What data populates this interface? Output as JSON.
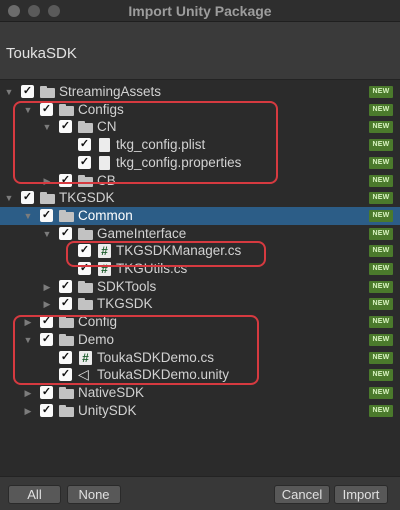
{
  "window": {
    "title": "Import Unity Package"
  },
  "header": {
    "package_name": "ToukaSDK"
  },
  "badge_text": "NEW",
  "tree": [
    {
      "label": "StreamingAssets",
      "depth": 0,
      "expanded": true,
      "checked": true,
      "icon": "folder-icon",
      "new": true
    },
    {
      "label": "Configs",
      "depth": 1,
      "expanded": true,
      "checked": true,
      "icon": "folder-icon",
      "new": true
    },
    {
      "label": "CN",
      "depth": 2,
      "expanded": true,
      "checked": true,
      "icon": "folder-icon",
      "new": true
    },
    {
      "label": "tkg_config.plist",
      "depth": 3,
      "expanded": null,
      "checked": true,
      "icon": "file-icon",
      "new": true
    },
    {
      "label": "tkg_config.properties",
      "depth": 3,
      "expanded": null,
      "checked": true,
      "icon": "file-icon",
      "new": true
    },
    {
      "label": "CB",
      "depth": 2,
      "expanded": false,
      "checked": true,
      "icon": "folder-icon",
      "new": true
    },
    {
      "label": "TKGSDK",
      "depth": 0,
      "expanded": true,
      "checked": true,
      "icon": "folder-icon",
      "new": true
    },
    {
      "label": "Common",
      "depth": 1,
      "expanded": true,
      "checked": true,
      "icon": "folder-icon",
      "new": true,
      "selected": true
    },
    {
      "label": "GameInterface",
      "depth": 2,
      "expanded": true,
      "checked": true,
      "icon": "folder-icon",
      "new": true
    },
    {
      "label": "TKGSDKManager.cs",
      "depth": 3,
      "expanded": null,
      "checked": true,
      "icon": "cs-script-icon",
      "new": true
    },
    {
      "label": "TKGUtils.cs",
      "depth": 3,
      "expanded": null,
      "checked": true,
      "icon": "cs-script-icon",
      "new": true
    },
    {
      "label": "SDKTools",
      "depth": 2,
      "expanded": false,
      "checked": true,
      "icon": "folder-icon",
      "new": true
    },
    {
      "label": "TKGSDK",
      "depth": 2,
      "expanded": false,
      "checked": true,
      "icon": "folder-icon",
      "new": true
    },
    {
      "label": "Config",
      "depth": 1,
      "expanded": false,
      "checked": true,
      "icon": "folder-icon",
      "new": true
    },
    {
      "label": "Demo",
      "depth": 1,
      "expanded": true,
      "checked": true,
      "icon": "folder-icon",
      "new": true
    },
    {
      "label": "ToukaSDKDemo.cs",
      "depth": 2,
      "expanded": null,
      "checked": true,
      "icon": "cs-script-icon",
      "new": true
    },
    {
      "label": "ToukaSDKDemo.unity",
      "depth": 2,
      "expanded": null,
      "checked": true,
      "icon": "unity-scene-icon",
      "new": true
    },
    {
      "label": "NativeSDK",
      "depth": 1,
      "expanded": false,
      "checked": true,
      "icon": "folder-icon",
      "new": true
    },
    {
      "label": "UnitySDK",
      "depth": 1,
      "expanded": false,
      "checked": true,
      "icon": "folder-icon",
      "new": true
    }
  ],
  "footer": {
    "all_label": "All",
    "none_label": "None",
    "cancel_label": "Cancel",
    "import_label": "Import"
  },
  "colors": {
    "selection": "#2c5d87",
    "highlight_box": "#d63a40",
    "new_badge": "#4b7a2c"
  }
}
